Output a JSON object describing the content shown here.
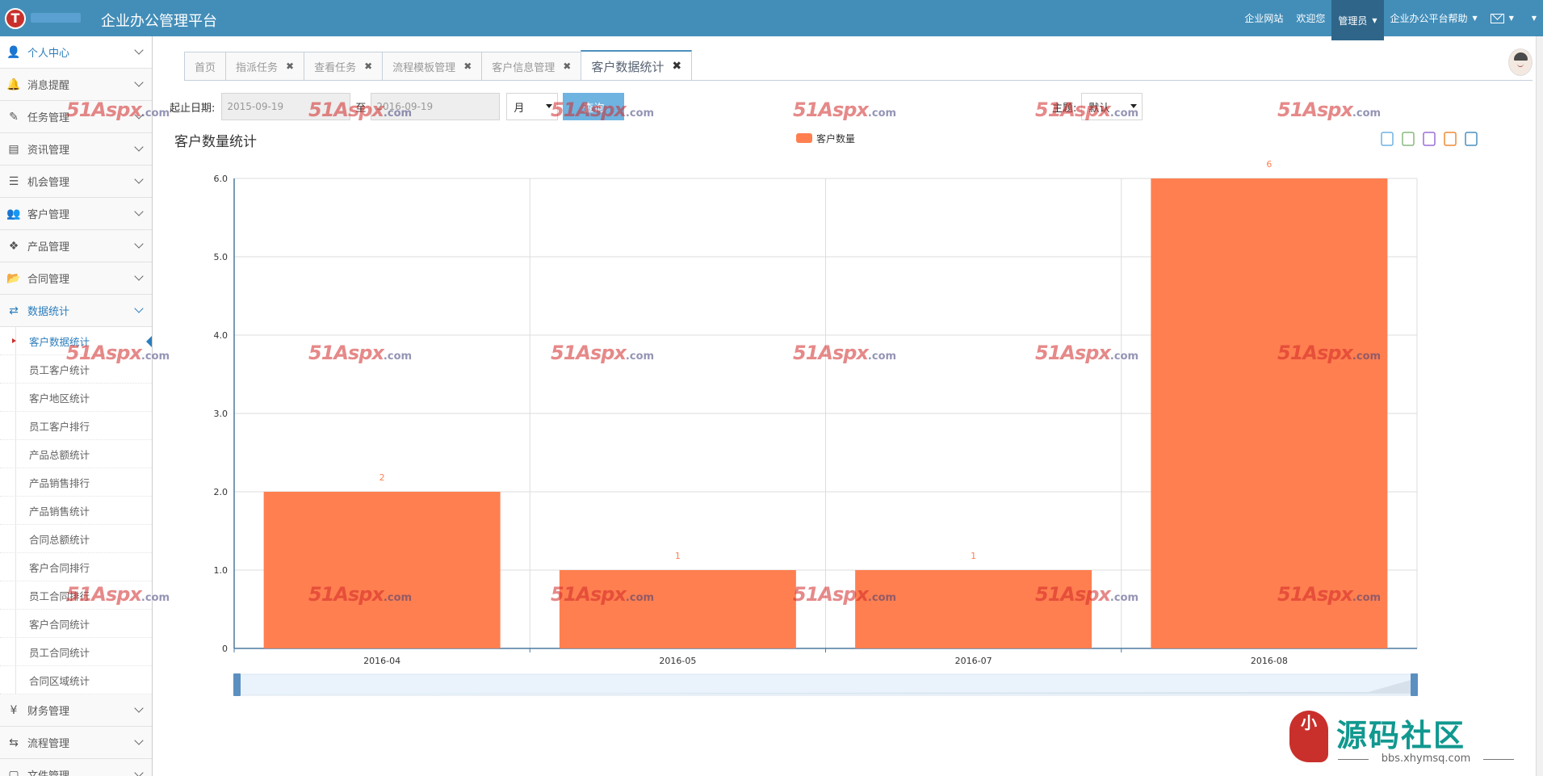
{
  "app": {
    "title": "企业办公管理平台",
    "logo_letter": "T"
  },
  "topnav": [
    {
      "label": "企业网站"
    },
    {
      "label": "欢迎您"
    },
    {
      "label": "管理员",
      "active": true,
      "dropdown": true
    },
    {
      "label": "企业办公平台帮助",
      "dropdown": true
    }
  ],
  "sidebar": {
    "items_top": [
      {
        "label": "个人中心",
        "icon": "user-icon",
        "glyph": "👤",
        "active": true
      },
      {
        "label": "消息提醒",
        "icon": "bell-icon",
        "glyph": "🔔"
      },
      {
        "label": "任务管理",
        "icon": "edit-icon",
        "glyph": "✎"
      },
      {
        "label": "资讯管理",
        "icon": "document-icon",
        "glyph": "▤"
      },
      {
        "label": "机会管理",
        "icon": "list-icon",
        "glyph": "☰"
      },
      {
        "label": "客户管理",
        "icon": "users-icon",
        "glyph": "👥"
      },
      {
        "label": "产品管理",
        "icon": "dropbox-icon",
        "glyph": "❖"
      },
      {
        "label": "合同管理",
        "icon": "folder-open-icon",
        "glyph": "📂"
      },
      {
        "label": "数据统计",
        "icon": "random-icon",
        "glyph": "⇄",
        "expanded": true
      }
    ],
    "sub_items": [
      {
        "label": "客户数据统计",
        "active": true
      },
      {
        "label": "员工客户统计"
      },
      {
        "label": "客户地区统计"
      },
      {
        "label": "员工客户排行"
      },
      {
        "label": "产品总额统计"
      },
      {
        "label": "产品销售排行"
      },
      {
        "label": "产品销售统计"
      },
      {
        "label": "合同总额统计"
      },
      {
        "label": "客户合同排行"
      },
      {
        "label": "员工合同排行"
      },
      {
        "label": "客户合同统计"
      },
      {
        "label": "员工合同统计"
      },
      {
        "label": "合同区域统计"
      }
    ],
    "items_bottom": [
      {
        "label": "财务管理",
        "icon": "yen-icon",
        "glyph": "¥"
      },
      {
        "label": "流程管理",
        "icon": "retweet-icon",
        "glyph": "⇆"
      },
      {
        "label": "文件管理",
        "icon": "file-icon",
        "glyph": "▢"
      }
    ]
  },
  "tabs": [
    {
      "label": "首页",
      "closable": false
    },
    {
      "label": "指派任务",
      "closable": true
    },
    {
      "label": "查看任务",
      "closable": true
    },
    {
      "label": "流程模板管理",
      "closable": true
    },
    {
      "label": "客户信息管理",
      "closable": true
    },
    {
      "label": "客户数据统计",
      "closable": true,
      "active": true
    }
  ],
  "filter": {
    "date_label": "起止日期:",
    "start_date": "2015-09-19",
    "separator": "至",
    "end_date": "2016-09-19",
    "period": "月",
    "query_label": "查询",
    "theme_label": "主题:",
    "theme_value": "默认"
  },
  "chart_data": {
    "type": "bar",
    "title": "客户数量统计",
    "legend": [
      "客户数量"
    ],
    "categories": [
      "2016-04",
      "2016-05",
      "2016-07",
      "2016-08"
    ],
    "series": [
      {
        "name": "客户数量",
        "values": [
          2,
          1,
          1,
          6
        ]
      }
    ],
    "y_ticks": [
      "0",
      "1.0",
      "2.0",
      "3.0",
      "4.0",
      "5.0",
      "6.0"
    ],
    "ylim": [
      0,
      6
    ],
    "grid": true,
    "legend_position": "top-center",
    "bar_color": "#ff7f50"
  },
  "toolbox_icons": [
    "data-view-icon",
    "line-chart-icon",
    "bar-chart-icon",
    "restore-icon",
    "save-image-icon"
  ],
  "watermark": {
    "main": "51Aspx",
    "suffix": ".com"
  },
  "brand": {
    "seal_text": "小",
    "title": "源码社区",
    "url": "bbs.xhymsq.com"
  },
  "colors": {
    "topbar": "#438eb9",
    "accent": "#2b7dbc",
    "bar": "#ff7f50"
  }
}
